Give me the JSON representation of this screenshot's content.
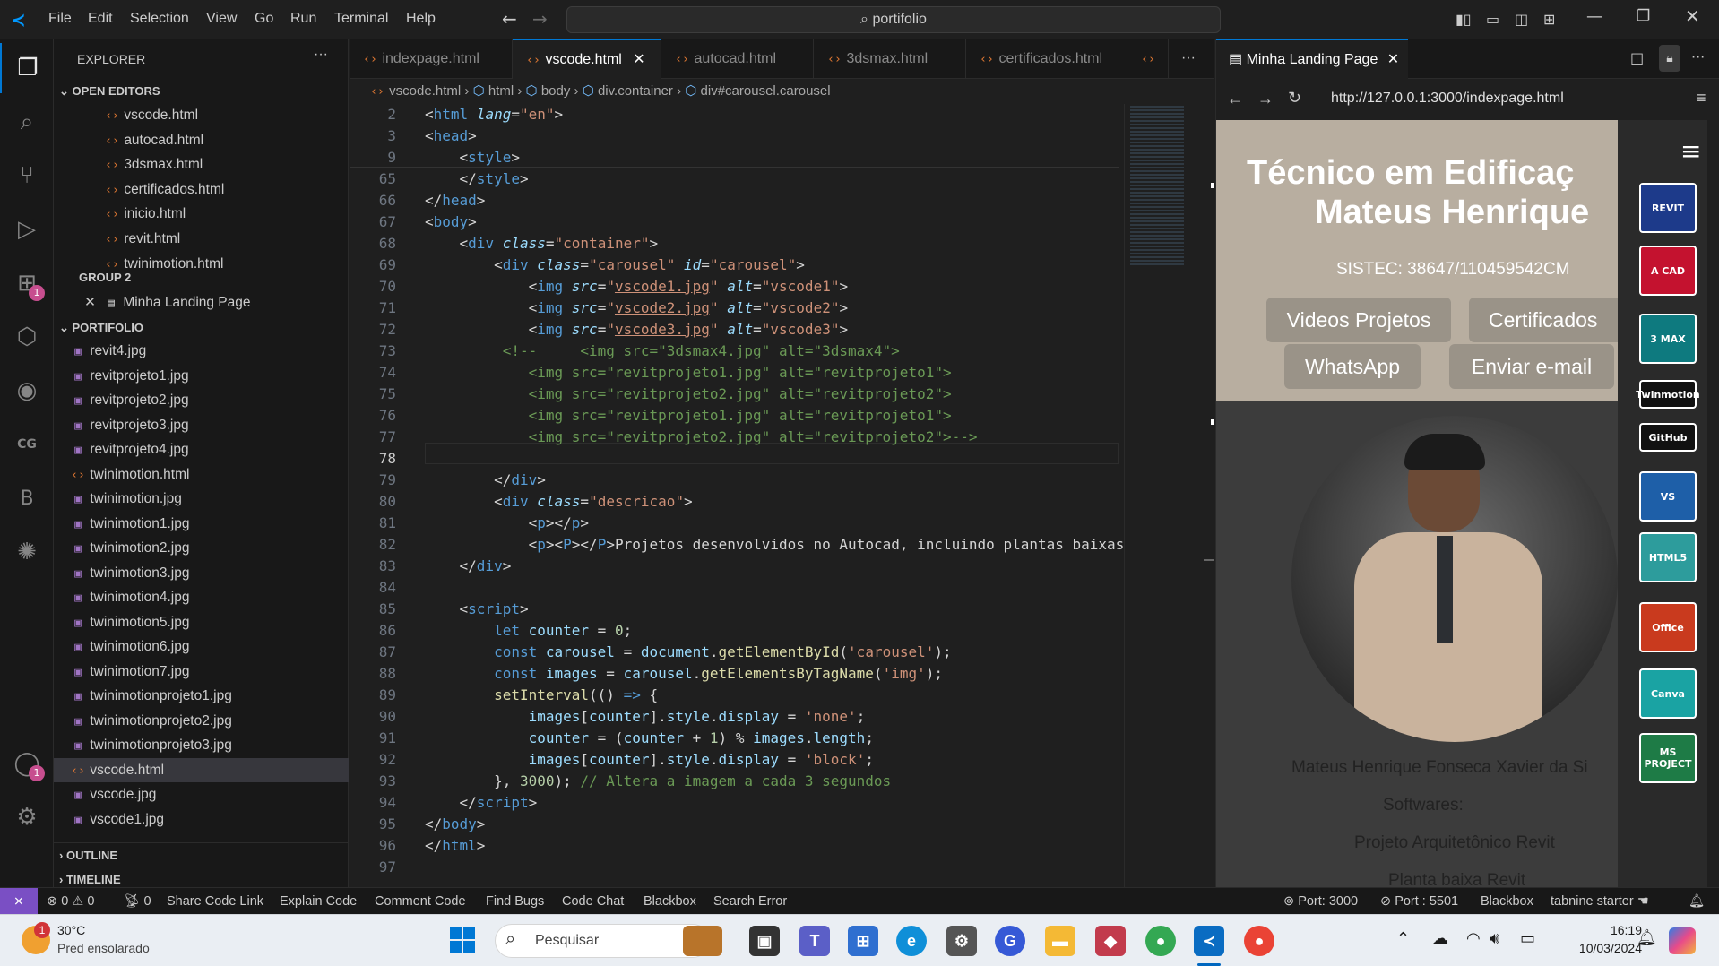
{
  "titlebar": {
    "menu": [
      "File",
      "Edit",
      "Selection",
      "View",
      "Go",
      "Run",
      "Terminal",
      "Help"
    ],
    "search": "portifolio"
  },
  "sidebar": {
    "title": "EXPLORER",
    "open_editors": "OPEN EDITORS",
    "group2": "GROUP 2",
    "portfolio": "PORTIFOLIO",
    "outline": "OUTLINE",
    "timeline": "TIMELINE",
    "open_files": [
      "vscode.html",
      "autocad.html",
      "3dsmax.html",
      "certificados.html",
      "inicio.html",
      "revit.html",
      "twinimotion.html"
    ],
    "group2_item": "Minha Landing Page",
    "files": [
      {
        "name": "revit4.jpg",
        "type": "img"
      },
      {
        "name": "revitprojeto1.jpg",
        "type": "img"
      },
      {
        "name": "revitprojeto2.jpg",
        "type": "img"
      },
      {
        "name": "revitprojeto3.jpg",
        "type": "img"
      },
      {
        "name": "revitprojeto4.jpg",
        "type": "img"
      },
      {
        "name": "twinimotion.html",
        "type": "html"
      },
      {
        "name": "twinimotion.jpg",
        "type": "img"
      },
      {
        "name": "twinimotion1.jpg",
        "type": "img"
      },
      {
        "name": "twinimotion2.jpg",
        "type": "img"
      },
      {
        "name": "twinimotion3.jpg",
        "type": "img"
      },
      {
        "name": "twinimotion4.jpg",
        "type": "img"
      },
      {
        "name": "twinimotion5.jpg",
        "type": "img"
      },
      {
        "name": "twinimotion6.jpg",
        "type": "img"
      },
      {
        "name": "twinimotion7.jpg",
        "type": "img"
      },
      {
        "name": "twinimotionprojeto1.jpg",
        "type": "img"
      },
      {
        "name": "twinimotionprojeto2.jpg",
        "type": "img"
      },
      {
        "name": "twinimotionprojeto3.jpg",
        "type": "img"
      },
      {
        "name": "vscode.html",
        "type": "html"
      },
      {
        "name": "vscode.jpg",
        "type": "img"
      },
      {
        "name": "vscode1.jpg",
        "type": "img"
      }
    ]
  },
  "tabs": [
    "indexpage.html",
    "vscode.html",
    "autocad.html",
    "3dsmax.html",
    "certificados.html"
  ],
  "breadcrumb": [
    "vscode.html",
    "html",
    "body",
    "div.container",
    "div#carousel.carousel"
  ],
  "editor": {
    "line_numbers": [
      "2",
      "3",
      "9",
      "65",
      "66",
      "67",
      "68",
      "69",
      "70",
      "71",
      "72",
      "73",
      "74",
      "75",
      "76",
      "77",
      "78",
      "79",
      "80",
      "81",
      "82",
      "83",
      "84",
      "85",
      "86",
      "87",
      "88",
      "89",
      "90",
      "91",
      "92",
      "93",
      "94",
      "95",
      "96",
      "97"
    ]
  },
  "preview": {
    "tab": "Minha Landing Page",
    "url": "http://127.0.0.1:3000/indexpage.html",
    "title1": "Técnico em Edificaç",
    "title2": "Mateus Henrique",
    "sistec": "SISTEC: 38647/110459542CM",
    "buttons": [
      "Videos Projetos",
      "Certificados",
      "WhatsApp",
      "Enviar e-mail"
    ],
    "name": "Mateus Henrique Fonseca Xavier da Si",
    "softwares": "Softwares:",
    "item1": "Projeto Arquitetônico Revit",
    "item2": "Planta baixa Revit",
    "logos": [
      "REVIT",
      "A CAD",
      "3 MAX",
      "Twinmotion",
      "GitHub",
      "VS",
      "HTML5",
      "Office",
      "Canva",
      "MS PROJECT"
    ]
  },
  "status": {
    "errors": "0",
    "warnings": "0",
    "radio": "0",
    "items": [
      "Share Code Link",
      "Explain Code",
      "Comment Code",
      "Find Bugs",
      "Code Chat",
      "Blackbox",
      "Search Error"
    ],
    "port1": "Port: 3000",
    "port2": "Port : 5501",
    "blackbox": "Blackbox",
    "tabnine": "tabnine starter"
  },
  "taskbar": {
    "temp": "30°C",
    "weather": "Pred ensolarado",
    "search": "Pesquisar",
    "time": "16:19",
    "date": "10/03/2024",
    "notif": "1"
  }
}
